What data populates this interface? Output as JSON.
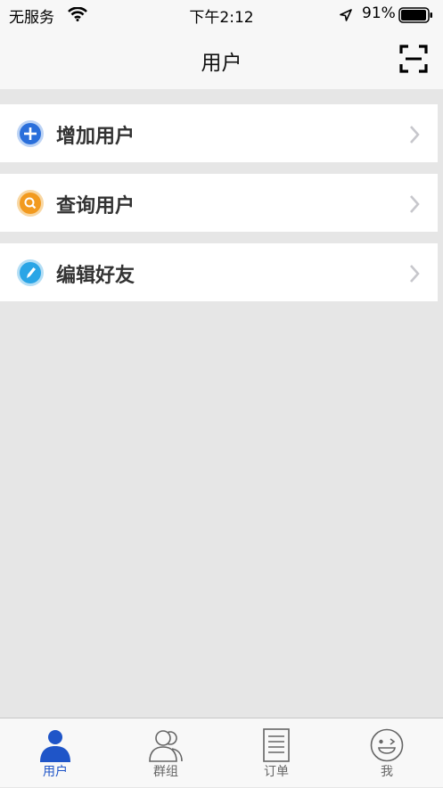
{
  "status_bar": {
    "carrier": "无服务",
    "time": "下午2:12",
    "battery": "91%"
  },
  "nav": {
    "title": "用户",
    "scan_icon": "scan-icon"
  },
  "menu": {
    "items": [
      {
        "label": "增加用户",
        "icon": "add-circle-icon",
        "color": "#2a6fdb"
      },
      {
        "label": "查询用户",
        "icon": "search-circle-icon",
        "color": "#f29a1f"
      },
      {
        "label": "编辑好友",
        "icon": "edit-circle-icon",
        "color": "#2aa5e6"
      }
    ]
  },
  "tab_bar": {
    "active_color": "#1f55c8",
    "items": [
      {
        "label": "用户",
        "icon": "user-icon",
        "active": true
      },
      {
        "label": "群组",
        "icon": "group-icon",
        "active": false
      },
      {
        "label": "订单",
        "icon": "order-icon",
        "active": false
      },
      {
        "label": "我",
        "icon": "me-icon",
        "active": false
      }
    ]
  }
}
